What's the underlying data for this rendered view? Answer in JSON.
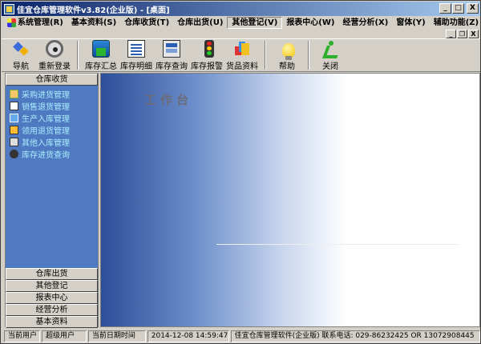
{
  "window": {
    "title": "佳宜仓库管理软件v3.82(企业版)  - [桌面]",
    "controls": {
      "minimize": "_",
      "maximize": "□",
      "close": "X"
    },
    "mdi_controls": {
      "minimize": "_",
      "restore": "❐",
      "close": "X"
    }
  },
  "menu": [
    {
      "label": "系统管理(R)"
    },
    {
      "label": "基本资料(S)"
    },
    {
      "label": "仓库收货(T)"
    },
    {
      "label": "仓库出货(U)"
    },
    {
      "label": "其他登记(V)"
    },
    {
      "label": "报表中心(W)"
    },
    {
      "label": "经营分析(X)"
    },
    {
      "label": "窗体(Y)"
    },
    {
      "label": "辅助功能(Z)"
    }
  ],
  "toolbar": [
    {
      "label": "导航",
      "icon": "nav-icon"
    },
    {
      "label": "重新登录",
      "icon": "relogin-icon"
    },
    {
      "label": "库存汇总",
      "icon": "stock-summary-icon"
    },
    {
      "label": "库存明细",
      "icon": "stock-detail-icon"
    },
    {
      "label": "库存查询",
      "icon": "stock-query-icon"
    },
    {
      "label": "库存报警",
      "icon": "stock-alarm-icon"
    },
    {
      "label": "货品资料",
      "icon": "goods-icon"
    },
    {
      "label": "帮助",
      "icon": "help-icon"
    },
    {
      "label": "关闭",
      "icon": "close-icon"
    }
  ],
  "sidebar": {
    "active_group": "仓库收货",
    "items": [
      {
        "label": "采购进货管理"
      },
      {
        "label": "销售退货管理"
      },
      {
        "label": "生产入库管理"
      },
      {
        "label": "领用退货管理"
      },
      {
        "label": "其他入库管理"
      },
      {
        "label": "库存进货查询"
      }
    ],
    "groups": [
      {
        "label": "仓库出货"
      },
      {
        "label": "其他登记"
      },
      {
        "label": "报表中心"
      },
      {
        "label": "经营分析"
      },
      {
        "label": "基本资料"
      }
    ]
  },
  "desktop": {
    "title": "工作台"
  },
  "status": {
    "user_label": "当前用户",
    "user_value": "超级用户",
    "datetime_label": "当前日期时间",
    "datetime_value": "2014-12-08 14:59:47",
    "contact": "佳宜仓库管理软件(企业版) 联系电话: 029-86232425 OR 13072908445"
  }
}
